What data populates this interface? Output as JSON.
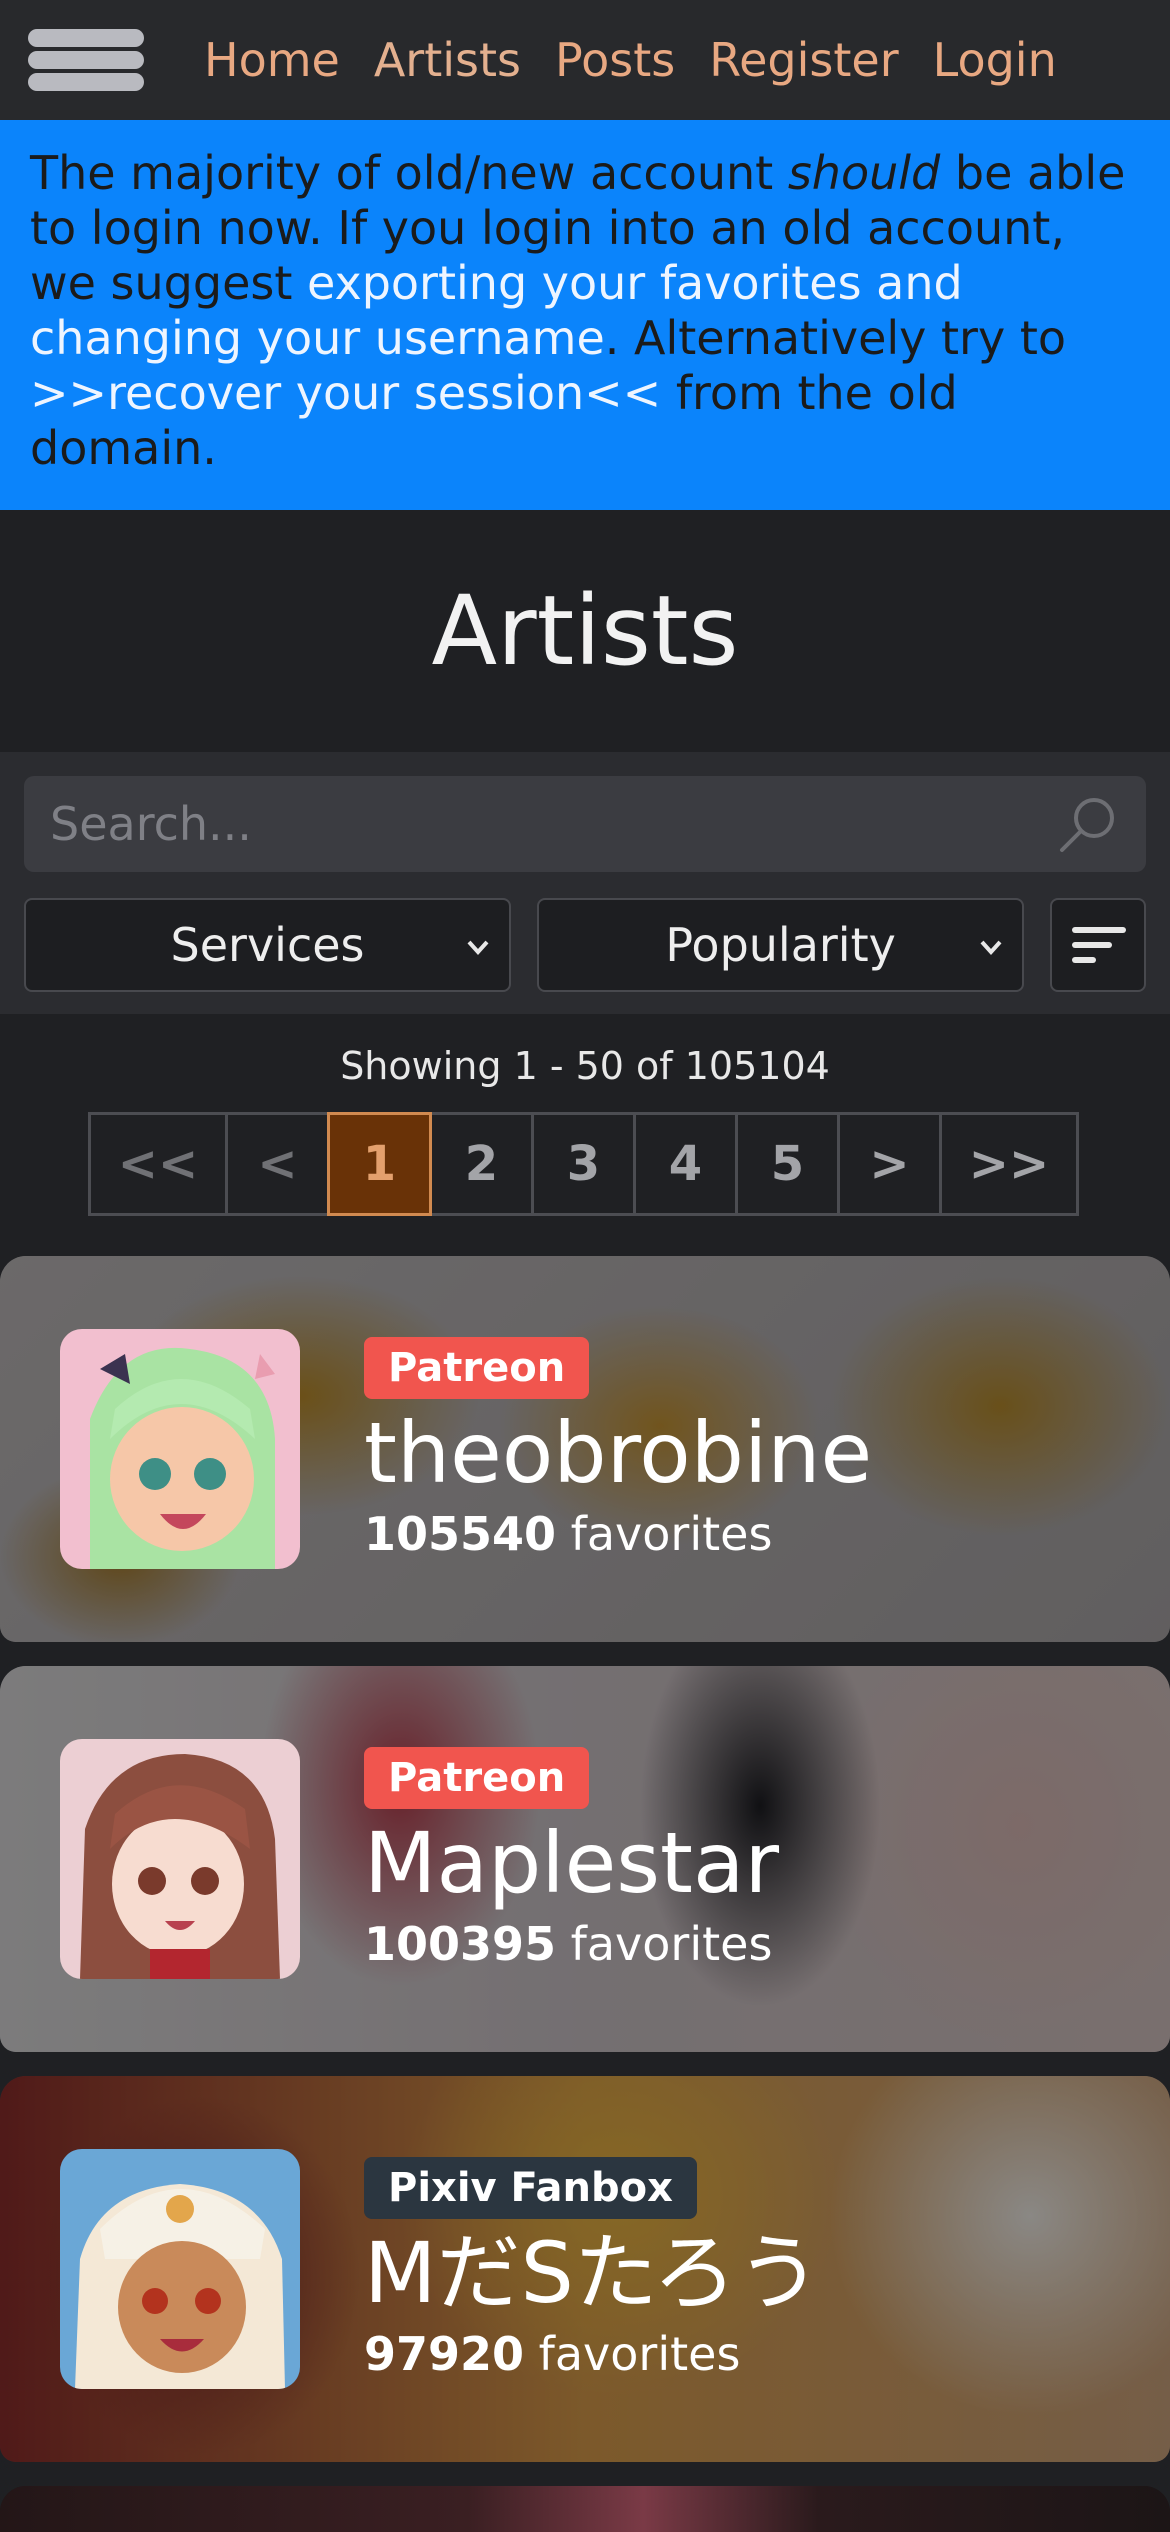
{
  "nav": {
    "links": [
      "Home",
      "Artists",
      "Posts",
      "Register",
      "Login"
    ]
  },
  "announcement": {
    "part1": "The majority of old/new account ",
    "emphasis": "should",
    "part2": " be able to login now. If you login into an old account, we suggest ",
    "link1": "exporting your favorites and changing your username",
    "part3": ". Alternatively try to ",
    "link2": ">>recover your session<<",
    "part4": " from the old domain."
  },
  "page": {
    "title": "Artists"
  },
  "search": {
    "placeholder": "Search..."
  },
  "filters": {
    "service": "Services",
    "sort_by": "Popularity"
  },
  "pagination": {
    "showing": "Showing 1 - 50 of 105104",
    "buttons": [
      "<<",
      "<",
      "1",
      "2",
      "3",
      "4",
      "5",
      ">",
      ">>"
    ],
    "current": "1"
  },
  "artists": [
    {
      "service": "Patreon",
      "name": "theobrobine",
      "favorites_count": "105540",
      "favorites_label": " favorites"
    },
    {
      "service": "Patreon",
      "name": "Maplestar",
      "favorites_count": "100395",
      "favorites_label": " favorites"
    },
    {
      "service": "Pixiv Fanbox",
      "name": "MだSたろう",
      "favorites_count": "97920",
      "favorites_label": " favorites"
    }
  ],
  "colors": {
    "announcement_bg": "#0b84fb",
    "nav_link": "#e8a882",
    "patreon_badge": "#f1554e",
    "fanbox_badge": "#2b3640",
    "current_page_bg": "#693207"
  }
}
